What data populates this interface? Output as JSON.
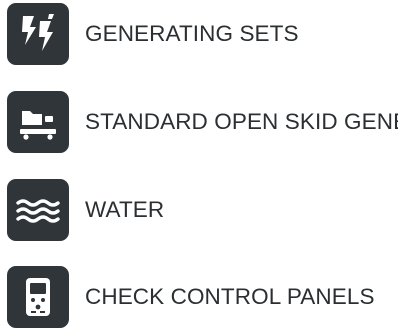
{
  "colors": {
    "icon_tile_bg": "#2f3538",
    "icon_fg": "#ffffff",
    "label_text": "#2b2f31"
  },
  "menu": {
    "items": [
      {
        "label": "GENERATING SETS",
        "icon": "lightning-bolts-icon"
      },
      {
        "label": "STANDARD OPEN SKID GENERATORS",
        "icon": "generator-skid-icon"
      },
      {
        "label": "WATER",
        "icon": "water-waves-icon"
      },
      {
        "label": "CHECK CONTROL PANELS",
        "icon": "control-panel-icon"
      }
    ]
  }
}
